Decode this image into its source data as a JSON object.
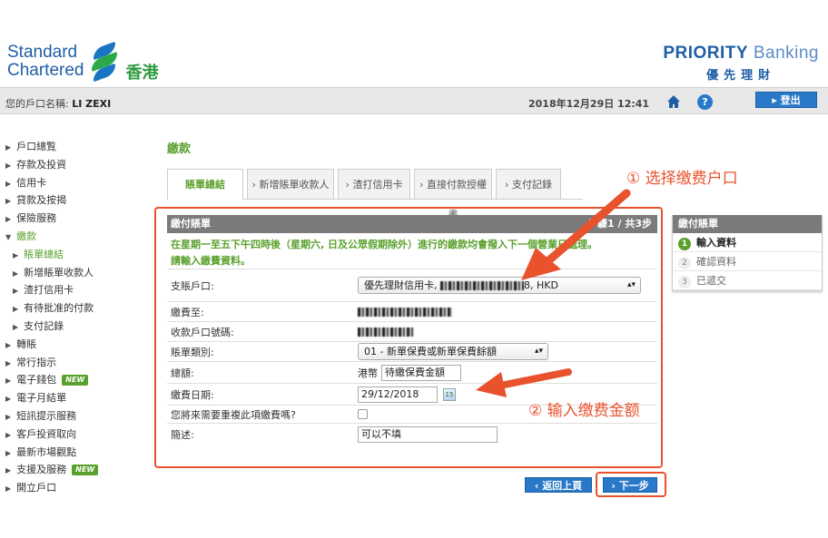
{
  "header": {
    "logo_line1": "Standard",
    "logo_line2": "Chartered",
    "logo_region": "香港",
    "priority_bold": "PRIORITY",
    "priority_light": "Banking",
    "priority_sub": "優先理財"
  },
  "userbar": {
    "account_label": "您的戶口名稱:",
    "account_name": "LI ZEXI",
    "datetime": "2018年12月29日 12:41",
    "help_glyph": "?",
    "logout_label": "登出"
  },
  "nav": {
    "items": [
      {
        "label": "戶口總覧"
      },
      {
        "label": "存款及投資"
      },
      {
        "label": "信用卡"
      },
      {
        "label": "貸款及按揭"
      },
      {
        "label": "保險服務"
      },
      {
        "label": "繳款"
      },
      {
        "label": "賬單總結"
      },
      {
        "label": "新增賬單收款人"
      },
      {
        "label": "渣打信用卡"
      },
      {
        "label": "有待批准的付款"
      },
      {
        "label": "支付記錄"
      },
      {
        "label": "轉賬"
      },
      {
        "label": "常行指示"
      },
      {
        "label": "電子錢包",
        "badge": "NEW"
      },
      {
        "label": "電子月結單"
      },
      {
        "label": "短訊提示服務"
      },
      {
        "label": "客戶投資取向"
      },
      {
        "label": "最新市場觀點"
      },
      {
        "label": "支援及服務",
        "badge": "NEW"
      },
      {
        "label": "開立戶口"
      }
    ]
  },
  "main": {
    "title": "繳款",
    "tabs": [
      {
        "label": "賬單總結"
      },
      {
        "label": "新增賬單收款人"
      },
      {
        "label": "渣打信用卡"
      },
      {
        "label": "直接付款授權書"
      },
      {
        "label": "支付記錄"
      }
    ],
    "panel_title": "繳付賬單",
    "step_text": "步驟1 / 共3步",
    "notice": "在星期一至五下午四時後（星期六, 日及公眾假期除外）進行的繳款均會撥入下一個營業日處理。",
    "prompt": "請輸入繳費資料。",
    "fields": {
      "from_account_label": "支賬戶口:",
      "from_account_prefix": "優先理財信用卡,",
      "from_account_suffix": "8, HKD",
      "payee_label": "繳費至:",
      "payee_account_label": "收款戶口號碼:",
      "bill_type_label": "賬單類別:",
      "bill_type_value": "01 - 新單保費或新單保費餘額",
      "amount_label": "總額:",
      "amount_currency": "港幣",
      "amount_value": "待繳保費金額",
      "date_label": "繳費日期:",
      "date_value": "29/12/2018",
      "calendar_glyph": "15",
      "repeat_label": "您將來需要重複此項繳費嗎?",
      "remarks_label": "簡述:",
      "remarks_value": "可以不填"
    },
    "back_label": "返回上頁",
    "next_label": "下一步"
  },
  "steps": {
    "title": "繳付賬單",
    "items": [
      {
        "num": "1",
        "label": "輸入資料"
      },
      {
        "num": "2",
        "label": "確認資料"
      },
      {
        "num": "3",
        "label": "已遞交"
      }
    ]
  },
  "annotations": {
    "note1": "① 选择缴费户口",
    "note2": "② 输入缴费金额",
    "color": "#e8522c"
  },
  "colors": {
    "brand_blue": "#1f5fa6",
    "brand_green": "#5aa02c",
    "button_blue": "#2a78c8",
    "panel_header_gray": "#7b7b7b"
  }
}
